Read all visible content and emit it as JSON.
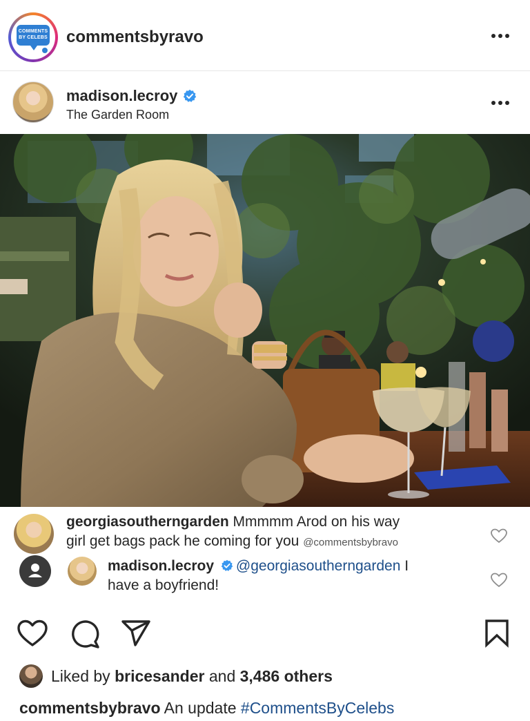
{
  "header": {
    "account_name": "commentsbyravo",
    "logo_text_line1": "COMMENTS",
    "logo_text_line2": "BY CELEBS"
  },
  "post": {
    "username": "madison.lecroy",
    "location": "The Garden Room",
    "verified": true
  },
  "comments": [
    {
      "username": "georgiasoutherngarden",
      "text_line1": "Mmmmm Arod on his way",
      "text_line2": "girl get bags pack he coming for you",
      "tag": "@commentsbybravo"
    },
    {
      "username": "madison.lecroy",
      "mention": "@georgiasoutherngarden",
      "text_tail": " I",
      "text_line2": "have a boyfriend!"
    }
  ],
  "likes": {
    "prefix": "Liked by ",
    "liker": "bricesander",
    "middle": " and ",
    "count": "3,486 others"
  },
  "caption": {
    "username": "commentsbybravo",
    "text": " An update ",
    "hashtag": "#CommentsByCelebs"
  },
  "icons": [
    "more-icon",
    "verified-badge-icon",
    "heart-icon",
    "comment-icon",
    "share-icon",
    "bookmark-icon"
  ]
}
